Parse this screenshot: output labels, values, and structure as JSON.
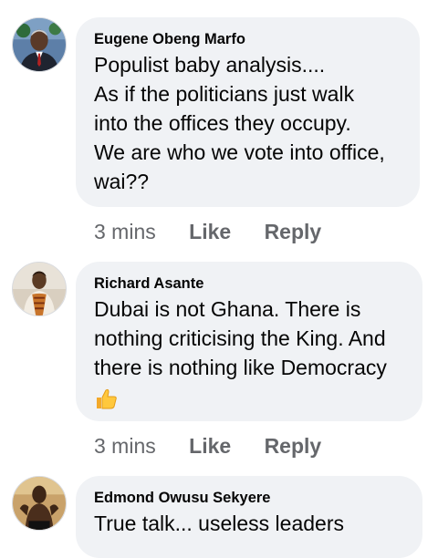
{
  "comments": [
    {
      "author": "Eugene Obeng Marfo",
      "lines": [
        "Populist baby analysis....",
        "As if the politicians just walk",
        "into the offices they occupy.",
        "We are who we vote into office,",
        "wai??"
      ],
      "time": "3 mins",
      "like_label": "Like",
      "reply_label": "Reply"
    },
    {
      "author": "Richard Asante",
      "lines": [
        "Dubai is not Ghana. There is",
        "nothing criticising the King. And",
        "there is nothing like Democracy"
      ],
      "emoji": "thumbs-up",
      "time": "3 mins",
      "like_label": "Like",
      "reply_label": "Reply"
    },
    {
      "author": "Edmond Owusu Sekyere",
      "lines": [
        "True talk... useless leaders"
      ]
    }
  ],
  "colors": {
    "bubble": "#f0f2f5",
    "text": "#050505",
    "muted": "#65676b"
  }
}
